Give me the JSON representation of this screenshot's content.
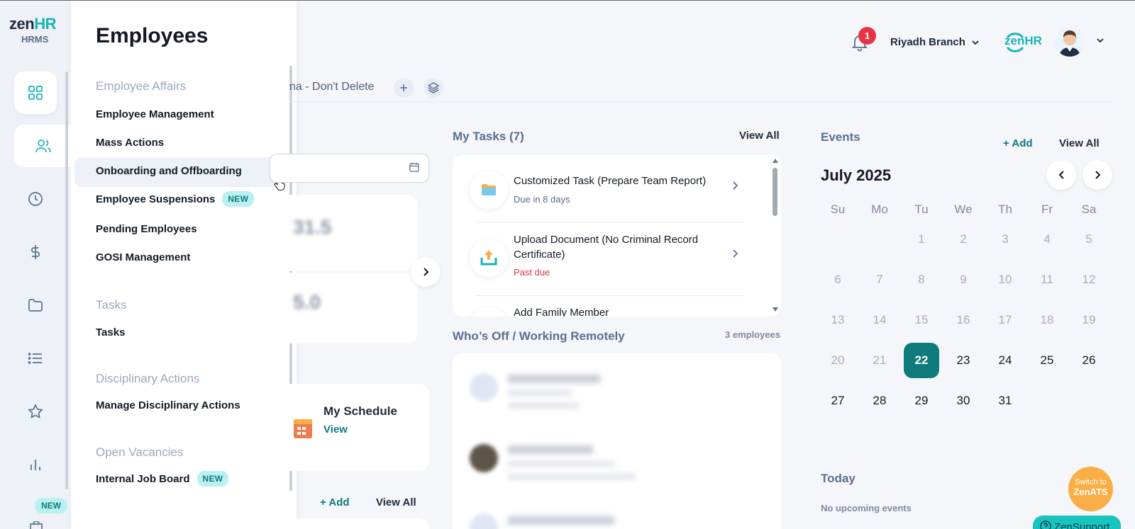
{
  "brand": {
    "logo_main": "zen",
    "logo_accent": "HR",
    "logo_sub": "HRMS",
    "accent_color": "#19b4b4",
    "primary_color": "#0f7b7d"
  },
  "rail": {
    "icons": [
      "grid-icon",
      "users-icon",
      "clock-icon",
      "dollar-icon",
      "folder-icon",
      "list-icon",
      "star-icon",
      "bar-chart-icon",
      "bag-icon"
    ],
    "new_badge": "NEW"
  },
  "flyout": {
    "title": "Employees",
    "sections": [
      {
        "heading": "Employee Affairs",
        "items": [
          {
            "label": "Employee Management"
          },
          {
            "label": "Mass Actions"
          },
          {
            "label": "Onboarding and Offboarding"
          },
          {
            "label": "Employee Suspensions",
            "badge": "NEW"
          },
          {
            "label": "Pending Employees"
          },
          {
            "label": "GOSI Management"
          }
        ]
      },
      {
        "heading": "Tasks",
        "items": [
          {
            "label": "Tasks"
          }
        ]
      },
      {
        "heading": "Disciplinary Actions",
        "items": [
          {
            "label": "Manage Disciplinary Actions"
          }
        ]
      },
      {
        "heading": "Open Vacancies",
        "items": [
          {
            "label": "Internal Job Board",
            "badge": "NEW"
          }
        ]
      }
    ]
  },
  "header": {
    "notifications": "1",
    "branch": "Riyadh Branch",
    "company_logo_main": "zen",
    "company_logo_accent": "HR"
  },
  "tabs": {
    "partial_tab": "na - Don't Delete"
  },
  "schedule": {
    "title": "My Schedule",
    "view": "View"
  },
  "left_section": {
    "add": "+ Add",
    "view_all": "View All"
  },
  "tasks": {
    "title": "My Tasks (7)",
    "view_all": "View All",
    "items": [
      {
        "title": "Customized Task (Prepare Team Report)",
        "sub": "Due in 8 days",
        "sub_color": "#5a6a85",
        "icon": "folder-icon"
      },
      {
        "title": "Upload Document (No Criminal Record Certificate)",
        "sub": "Past due",
        "sub_color": "#e53343",
        "icon": "upload-icon"
      },
      {
        "title": "Add Family Member",
        "sub": "",
        "sub_color": "#5a6a85",
        "icon": "family-icon"
      }
    ]
  },
  "whos_off": {
    "title": "Who’s Off / Working Remotely",
    "count": "3 employees"
  },
  "events": {
    "title": "Events",
    "add": "+ Add",
    "view_all": "View All",
    "month": "July 2025",
    "weekdays": [
      "Su",
      "Mo",
      "Tu",
      "We",
      "Th",
      "Fr",
      "Sa"
    ],
    "first_weekday_index": 2,
    "days_in_month": 31,
    "selected_day": 22,
    "today_title": "Today",
    "no_events": "No upcoming events"
  },
  "floating": {
    "switch_line1": "Switch to",
    "switch_line2": "ZenATS",
    "support": "ZenSupport"
  }
}
